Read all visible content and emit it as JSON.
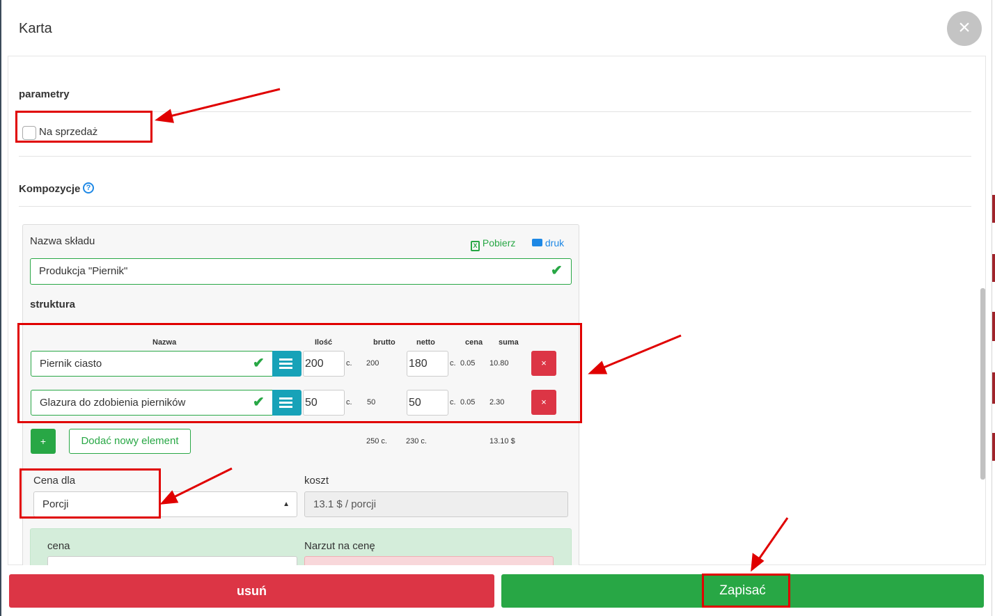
{
  "modal": {
    "title": "Karta",
    "close": "×"
  },
  "parametry": {
    "title": "parametry",
    "checkbox_label": "Na sprzedaż"
  },
  "kompozycje": {
    "title": "Kompozycje",
    "help": "?"
  },
  "card": {
    "warehouse_label": "Nazwa składu",
    "download": "Pobierz",
    "print": "druk",
    "warehouse_value": "Produkcja \"Piernik\"",
    "structure_title": "struktura",
    "columns": {
      "name": "Nazwa",
      "qty": "Ilość",
      "gross": "brutto",
      "net": "netto",
      "price": "cena",
      "sum": "suma"
    },
    "rows": [
      {
        "name": "Piernik ciasto",
        "qty": "200",
        "unit": "c.",
        "gross": "200",
        "net": "180",
        "net_unit": "c.",
        "price": "0.05",
        "sum": "10.80"
      },
      {
        "name": "Glazura do zdobienia pierników",
        "qty": "50",
        "unit": "c.",
        "gross": "50",
        "net": "50",
        "net_unit": "c.",
        "price": "0.05",
        "sum": "2.30"
      }
    ],
    "delete_icon": "×",
    "add_plus": "+",
    "add_label": "Dodać nowy element",
    "totals": {
      "gross": "250 c.",
      "net": "230 c.",
      "sum": "13.10 $"
    },
    "price_for_label": "Cena dla",
    "price_for_value": "Porcji",
    "cost_label": "koszt",
    "cost_value": "13.1 $ / porcji",
    "price_label": "cena",
    "markup_label": "Narzut na cenę"
  },
  "footer": {
    "delete": "usuń",
    "save": "Zapisać"
  },
  "colors": {
    "red": "#dc3545",
    "green": "#28a745",
    "info": "#17a2b8",
    "annotation": "#e00000"
  }
}
